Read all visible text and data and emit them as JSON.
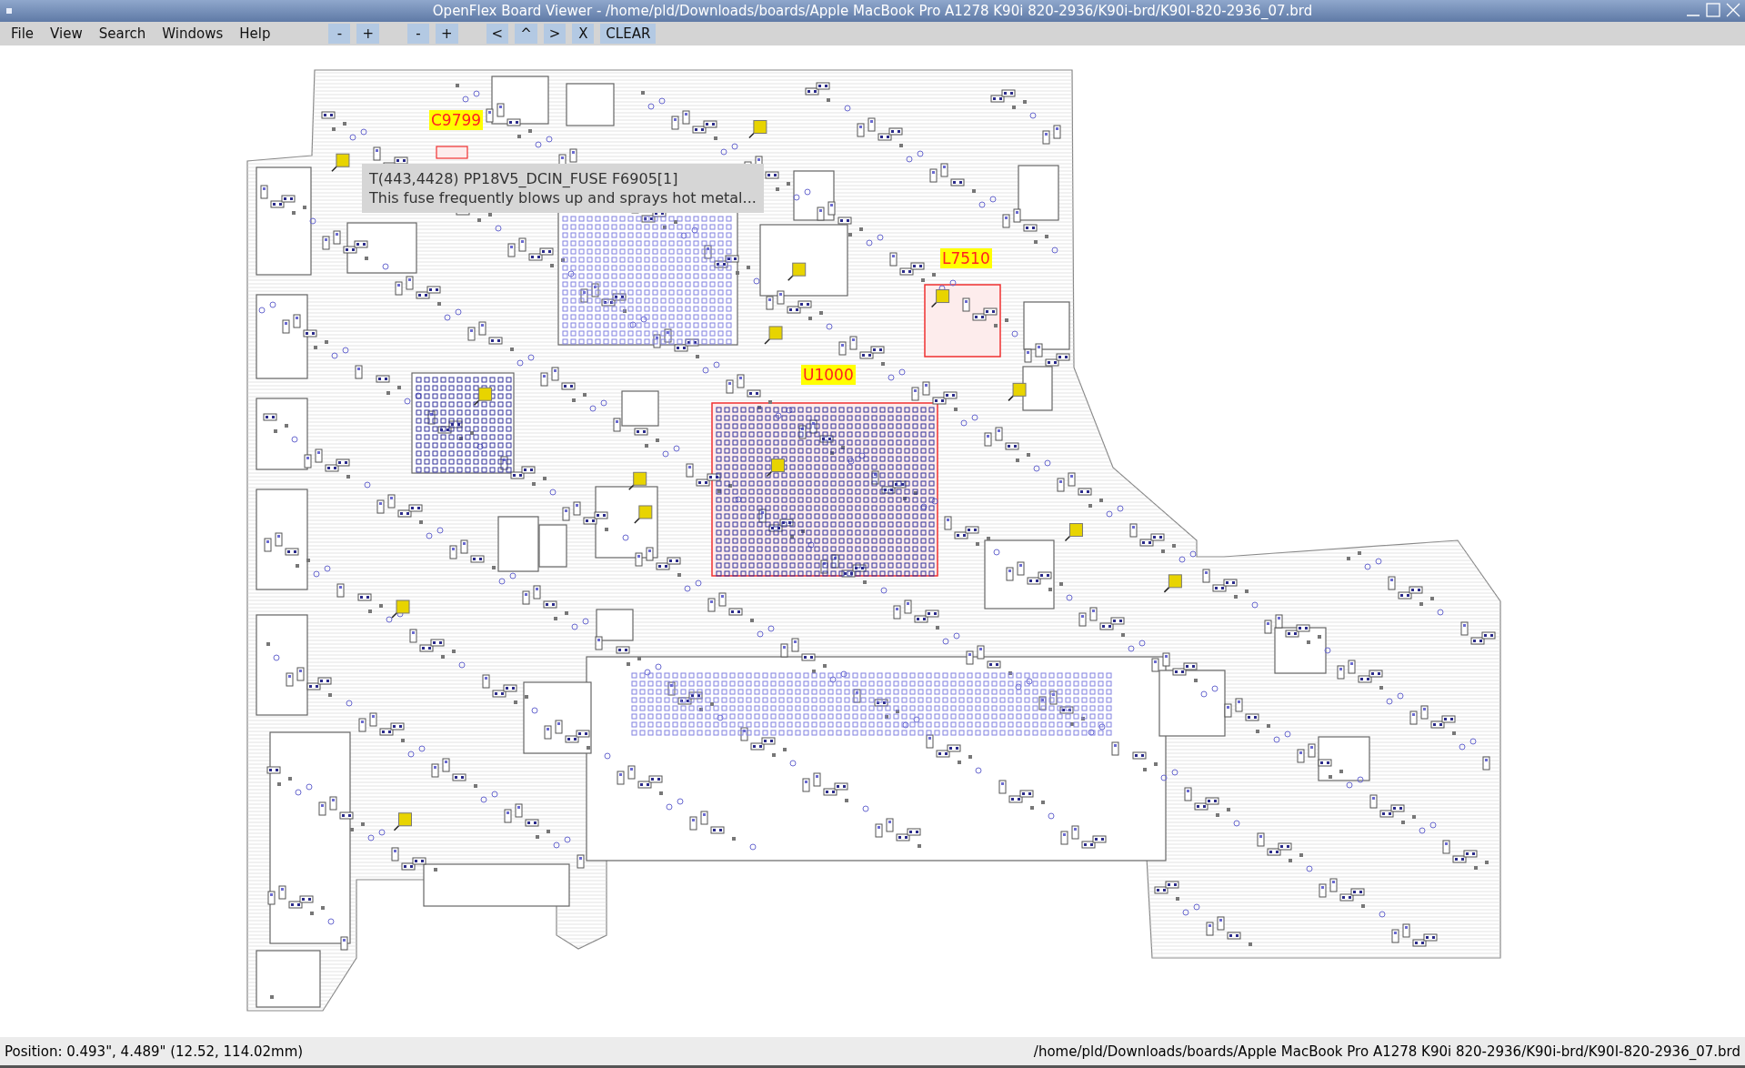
{
  "window": {
    "title": "OpenFlex Board Viewer - /home/pld/Downloads/boards/Apple MacBook Pro A1278 K90i 820-2936/K90i-brd/K90I-820-2936_07.brd"
  },
  "menu": [
    "File",
    "View",
    "Search",
    "Windows",
    "Help"
  ],
  "toolbar": [
    [
      "-",
      "+"
    ],
    [
      "-",
      "+"
    ],
    [
      "<",
      "^",
      ">",
      "X",
      "CLEAR"
    ]
  ],
  "board_labels": [
    "C9799",
    "L7510",
    "U1000"
  ],
  "tooltip": {
    "lines": [
      "T(443,4428) PP18V5_DCIN_FUSE F6905[1]",
      "This fuse frequently blows up and sprays hot metal..."
    ]
  },
  "status_bar": {
    "position": "Position: 0.493\", 4.489\" (12.52, 114.02mm)",
    "file": "/home/pld/Downloads/boards/Apple MacBook Pro A1278 K90i 820-2936/K90i-brd/K90I-820-2936_07.brd"
  }
}
